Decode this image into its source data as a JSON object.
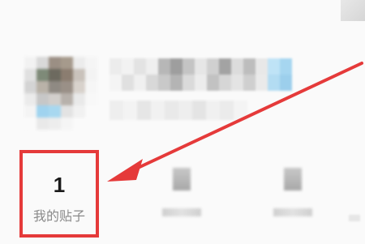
{
  "profile": {
    "avatar_icon": "avatar-mosaic",
    "username_redacted": true
  },
  "stats": {
    "posts": {
      "count": "1",
      "label": "我的贴子"
    }
  },
  "annotation": {
    "arrow_color": "#e53a3a",
    "highlight_color": "#e53a3a"
  }
}
